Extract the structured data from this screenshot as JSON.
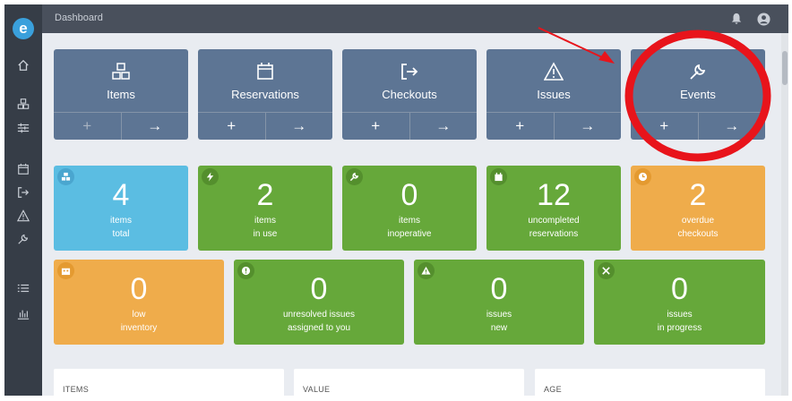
{
  "app": {
    "logo_letter": "e",
    "title": "Dashboard"
  },
  "sidebar": {
    "items": [
      {
        "icon": "home-icon"
      },
      {
        "icon": "cubes-icon"
      },
      {
        "icon": "sliders-icon"
      },
      {
        "icon": "calendar-icon"
      },
      {
        "icon": "checkout-icon"
      },
      {
        "icon": "warning-icon"
      },
      {
        "icon": "wrench-icon"
      },
      {
        "icon": "list-icon"
      },
      {
        "icon": "chart-icon"
      }
    ]
  },
  "header": {
    "icons": [
      "bell-icon",
      "user-icon"
    ]
  },
  "tiles": [
    {
      "label": "Items",
      "icon": "cubes-icon",
      "add": "+",
      "go": "→",
      "add_disabled": true
    },
    {
      "label": "Reservations",
      "icon": "calendar-icon",
      "add": "+",
      "go": "→"
    },
    {
      "label": "Checkouts",
      "icon": "checkout-icon",
      "add": "+",
      "go": "→"
    },
    {
      "label": "Issues",
      "icon": "warning-icon",
      "add": "+",
      "go": "→"
    },
    {
      "label": "Events",
      "icon": "wrench-icon",
      "add": "+",
      "go": "→"
    }
  ],
  "stats_row1": [
    {
      "value": "4",
      "line1": "items",
      "line2": "total",
      "color": "blue",
      "icon": "cubes-icon"
    },
    {
      "value": "2",
      "line1": "items",
      "line2": "in use",
      "color": "green",
      "icon": "bolt-icon"
    },
    {
      "value": "0",
      "line1": "items",
      "line2": "inoperative",
      "color": "green",
      "icon": "wrench-icon"
    },
    {
      "value": "12",
      "line1": "uncompleted",
      "line2": "reservations",
      "color": "green",
      "icon": "calendar-icon"
    },
    {
      "value": "2",
      "line1": "overdue",
      "line2": "checkouts",
      "color": "orange",
      "icon": "clock-icon"
    }
  ],
  "stats_row2": [
    {
      "value": "0",
      "line1": "low",
      "line2": "inventory",
      "color": "orange",
      "icon": "inventory-icon"
    },
    {
      "value": "0",
      "line1": "unresolved issues",
      "line2": "assigned to you",
      "color": "green",
      "icon": "alert-circle-icon"
    },
    {
      "value": "0",
      "line1": "issues",
      "line2": "new",
      "color": "green",
      "icon": "warning-icon"
    },
    {
      "value": "0",
      "line1": "issues",
      "line2": "in progress",
      "color": "green",
      "icon": "tools-icon"
    }
  ],
  "panels": [
    {
      "title": "ITEMS"
    },
    {
      "title": "VALUE"
    },
    {
      "title": "AGE"
    }
  ],
  "colors": {
    "sidebar": "#363d47",
    "tile": "#5d7594",
    "blue": "#5bbde2",
    "green": "#66a83a",
    "orange": "#efac4b",
    "annotation": "#e8141b"
  }
}
